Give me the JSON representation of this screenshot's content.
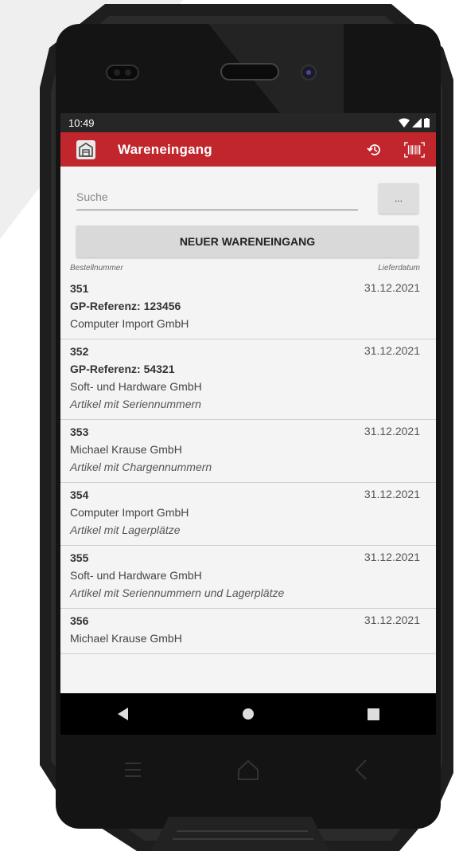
{
  "status": {
    "time": "10:49"
  },
  "appbar": {
    "title": "Wareneingang",
    "logo_icon": "warehouse-box-icon",
    "actions": [
      "history-icon",
      "barcode-scan-icon"
    ],
    "color": "#c0262c"
  },
  "search": {
    "placeholder": "Suche",
    "value": "",
    "more_label": "..."
  },
  "new_button": {
    "label": "NEUER WARENEINGANG"
  },
  "list_header": {
    "left": "Bestellnummer",
    "right": "Lieferdatum"
  },
  "rows": [
    {
      "number": "351",
      "date": "31.12.2021",
      "ref": "GP-Referenz: 123456",
      "company": "Computer Import GmbH",
      "note": ""
    },
    {
      "number": "352",
      "date": "31.12.2021",
      "ref": "GP-Referenz: 54321",
      "company": "Soft- und Hardware GmbH",
      "note": "Artikel mit Seriennummern"
    },
    {
      "number": "353",
      "date": "31.12.2021",
      "ref": "",
      "company": "Michael Krause GmbH",
      "note": "Artikel mit Chargennummern"
    },
    {
      "number": "354",
      "date": "31.12.2021",
      "ref": "",
      "company": "Computer Import GmbH",
      "note": "Artikel mit Lagerplätze"
    },
    {
      "number": "355",
      "date": "31.12.2021",
      "ref": "",
      "company": "Soft- und Hardware GmbH",
      "note": "Artikel mit Seriennummern und Lagerplätze"
    },
    {
      "number": "356",
      "date": "31.12.2021",
      "ref": "",
      "company": "Michael Krause GmbH",
      "note": ""
    }
  ],
  "navbar": {
    "buttons": [
      "back-icon",
      "home-icon",
      "recents-icon"
    ]
  }
}
